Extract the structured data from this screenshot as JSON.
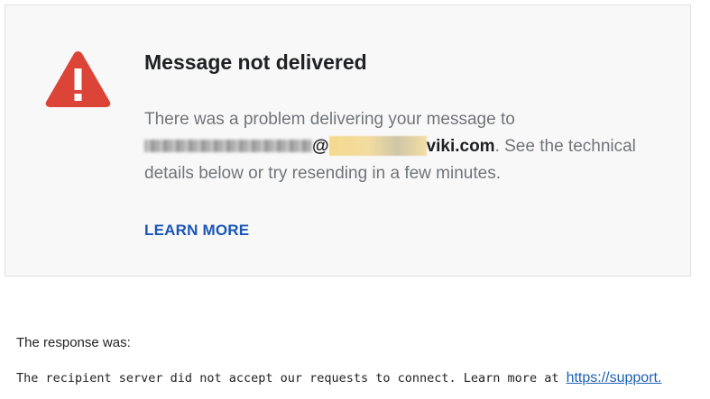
{
  "card": {
    "title": "Message not delivered",
    "message_prefix": "There was a problem delivering your message to",
    "at_sign": "@",
    "domain": "viki.com",
    "message_suffix_1": ". See the technical",
    "message_line_3": "details below or try resending in a few minutes.",
    "learn_more_label": "LEARN MORE",
    "icon": "warning-triangle-icon"
  },
  "response": {
    "label": "The response was:",
    "text": "The recipient server did not accept our requests to connect. Learn more at ",
    "link_text": "https://support."
  },
  "colors": {
    "warning_red": "#db4437",
    "link_blue": "#1a56b8",
    "card_background": "#f8f8f8"
  }
}
